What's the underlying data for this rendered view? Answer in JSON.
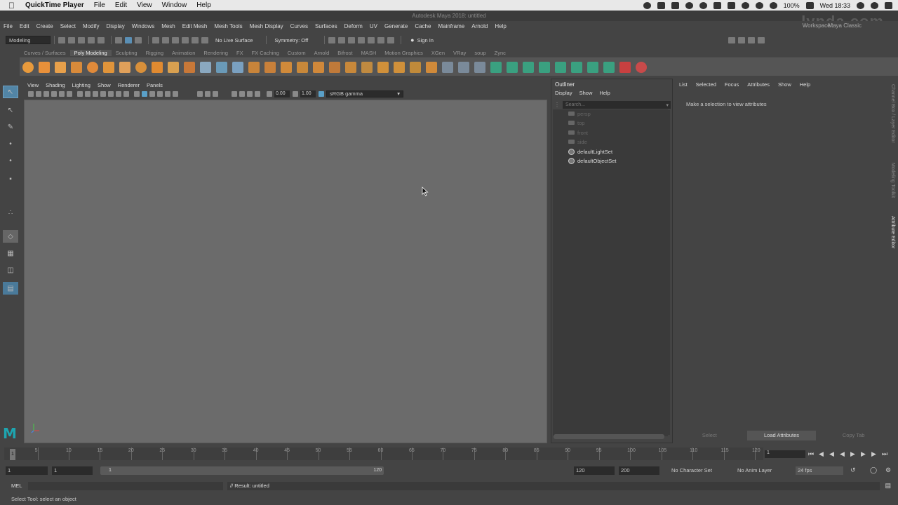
{
  "macos_menubar": {
    "app": "QuickTime Player",
    "items": [
      "File",
      "Edit",
      "View",
      "Window",
      "Help"
    ],
    "battery": "100%",
    "clock": "Wed 18:33"
  },
  "window": {
    "title": "Autodesk Maya 2018: untitled"
  },
  "watermark": "lynda.com",
  "main_menu": [
    "File",
    "Edit",
    "Create",
    "Select",
    "Modify",
    "Display",
    "Windows",
    "Mesh",
    "Edit Mesh",
    "Mesh Tools",
    "Mesh Display",
    "Curves",
    "Surfaces",
    "Deform",
    "UV",
    "Generate",
    "Cache",
    "Mainframe",
    "Arnold",
    "Help"
  ],
  "workspace": {
    "label": "Workspace :",
    "value": "Maya Classic"
  },
  "status_line": {
    "menuset": "Modeling",
    "live_surface": "No Live Surface",
    "symmetry": "Symmetry: Off",
    "sign_in": "Sign In"
  },
  "shelf_tabs": [
    "Curves / Surfaces",
    "Poly Modeling",
    "Sculpting",
    "Rigging",
    "Animation",
    "Rendering",
    "FX",
    "FX Caching",
    "Custom",
    "Arnold",
    "Bifrost",
    "MASH",
    "Motion Graphics",
    "XGen",
    "VRay",
    "soup",
    "Zync"
  ],
  "shelf_active": "Poly Modeling",
  "viewport": {
    "menu": [
      "View",
      "Shading",
      "Lighting",
      "Show",
      "Renderer",
      "Panels"
    ],
    "exposure": "0.00",
    "gamma": "1.00",
    "color_space": "sRGB gamma"
  },
  "outliner": {
    "title": "Outliner",
    "menu": [
      "Display",
      "Show",
      "Help"
    ],
    "search_placeholder": "Search...",
    "items": [
      {
        "label": "persp",
        "type": "camera"
      },
      {
        "label": "top",
        "type": "camera"
      },
      {
        "label": "front",
        "type": "camera"
      },
      {
        "label": "side",
        "type": "camera"
      },
      {
        "label": "defaultLightSet",
        "type": "set"
      },
      {
        "label": "defaultObjectSet",
        "type": "set"
      }
    ]
  },
  "attribute_editor": {
    "menu": [
      "List",
      "Selected",
      "Focus",
      "Attributes",
      "Show",
      "Help"
    ],
    "message": "Make a selection to view attributes",
    "buttons": [
      "Select",
      "Load Attributes",
      "Copy Tab"
    ]
  },
  "side_tabs": [
    "Channel Box / Layer Editor",
    "Modeling Toolkit",
    "Attribute Editor"
  ],
  "timeline": {
    "labels": [
      "5",
      "10",
      "15",
      "20",
      "25",
      "30",
      "35",
      "40",
      "45",
      "50",
      "55",
      "60",
      "65",
      "70",
      "75",
      "80",
      "85",
      "90",
      "95",
      "100",
      "105",
      "110",
      "115",
      "120"
    ],
    "current_frame": "1",
    "frame_field": "1"
  },
  "range": {
    "start": "1",
    "playback_start": "1",
    "range_start": "1",
    "range_end": "120",
    "playback_end": "120",
    "end": "200",
    "character_set": "No Character Set",
    "anim_layer": "No Anim Layer",
    "fps": "24 fps"
  },
  "command_line": {
    "language": "MEL",
    "result": "// Result: untitled"
  },
  "help_line": "Select Tool: select an object"
}
